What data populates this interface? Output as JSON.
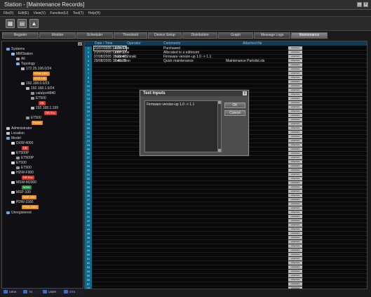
{
  "window": {
    "title": "Station - [Maintenance Records]",
    "min": "_",
    "close": "x"
  },
  "menu": [
    "File(F)",
    "Edit(E)",
    "View(V)",
    "Function(U)",
    "Tool(T)",
    "Help(H)"
  ],
  "toolbar": [
    "save-icon",
    "folder-icon",
    "network-icon"
  ],
  "tabs": [
    "Register",
    "Monitor",
    "Scheduler",
    "Threshold",
    "Device Setup",
    "Distribution",
    "Graph",
    "Message Logs",
    "Maintenance"
  ],
  "active_tab": "Maintenance",
  "tree": {
    "systems": "Systems",
    "mmstation": "MMStation",
    "all": "All",
    "topology": "Topology",
    "ip1": "172.25.106.0/24",
    "pdw": "PDW-1500",
    "ecs": "ECS-100",
    "ip2": "192.168.0.0/23",
    "ip3": "192.168.1.0/24",
    "cs": "catalyst4840",
    "et1": "ET500",
    "db": "DB",
    "ip4": "192.168.1.199",
    "dr1": "DR Enc",
    "et2": "ET500",
    "router": "Router",
    "administrator": "Administrator",
    "location": "Location",
    "model": "Model",
    "m1": "DXW-4000",
    "m1c": "DB",
    "m2": "ET500P",
    "m2c": "ET500P",
    "m3": "ET500",
    "m3c": "ET500",
    "m4": "HDW-F900",
    "m4c": "DR Enc",
    "m5": "MSW-M2000",
    "m5c": "MSW",
    "m6": "MSP-100",
    "m6c": "MSP-100",
    "m7": "PDW-1500",
    "m7c": "PDW-1500",
    "unregistered": "Unregistered"
  },
  "bottom_tabs": [
    "VIEW",
    "TS",
    "USER",
    "OTX"
  ],
  "grid": {
    "headers": {
      "date": "Date / Time",
      "operator": "Operator",
      "comments": "Comments",
      "attached": "Attached file"
    },
    "rows": [
      {
        "date": "21/07/2005 14:29:57",
        "operator": "John Doe",
        "comment": "Purchased",
        "file": ""
      },
      {
        "date": "21/07/2005 11:07:37",
        "operator": "John Doe",
        "comment": "Allocated to a editroom",
        "file": ""
      },
      {
        "date": "07/08/2005 15:39:48",
        "operator": "Naomi Shiraki",
        "comment": "Firmware version-up 1.0 -> 1.1",
        "file": ""
      },
      {
        "date": "29/08/2005 17:43:29",
        "operator": "Keiko Bon",
        "comment": "Quick maintenance",
        "file": "Maintenance Partslist.xls"
      }
    ],
    "row_count": 58,
    "attach_label": "Attached"
  },
  "dialog": {
    "title": "Text Inputs",
    "text": "Firmware version-up 1.0 -> 1.1",
    "ok": "OK",
    "cancel": "Cancel"
  },
  "colors": {
    "accent": "#0a6b8f",
    "badge_red": "#d8342c",
    "badge_orange": "#e8891f",
    "badge_green": "#2e8b3e",
    "header": "#103a55"
  }
}
